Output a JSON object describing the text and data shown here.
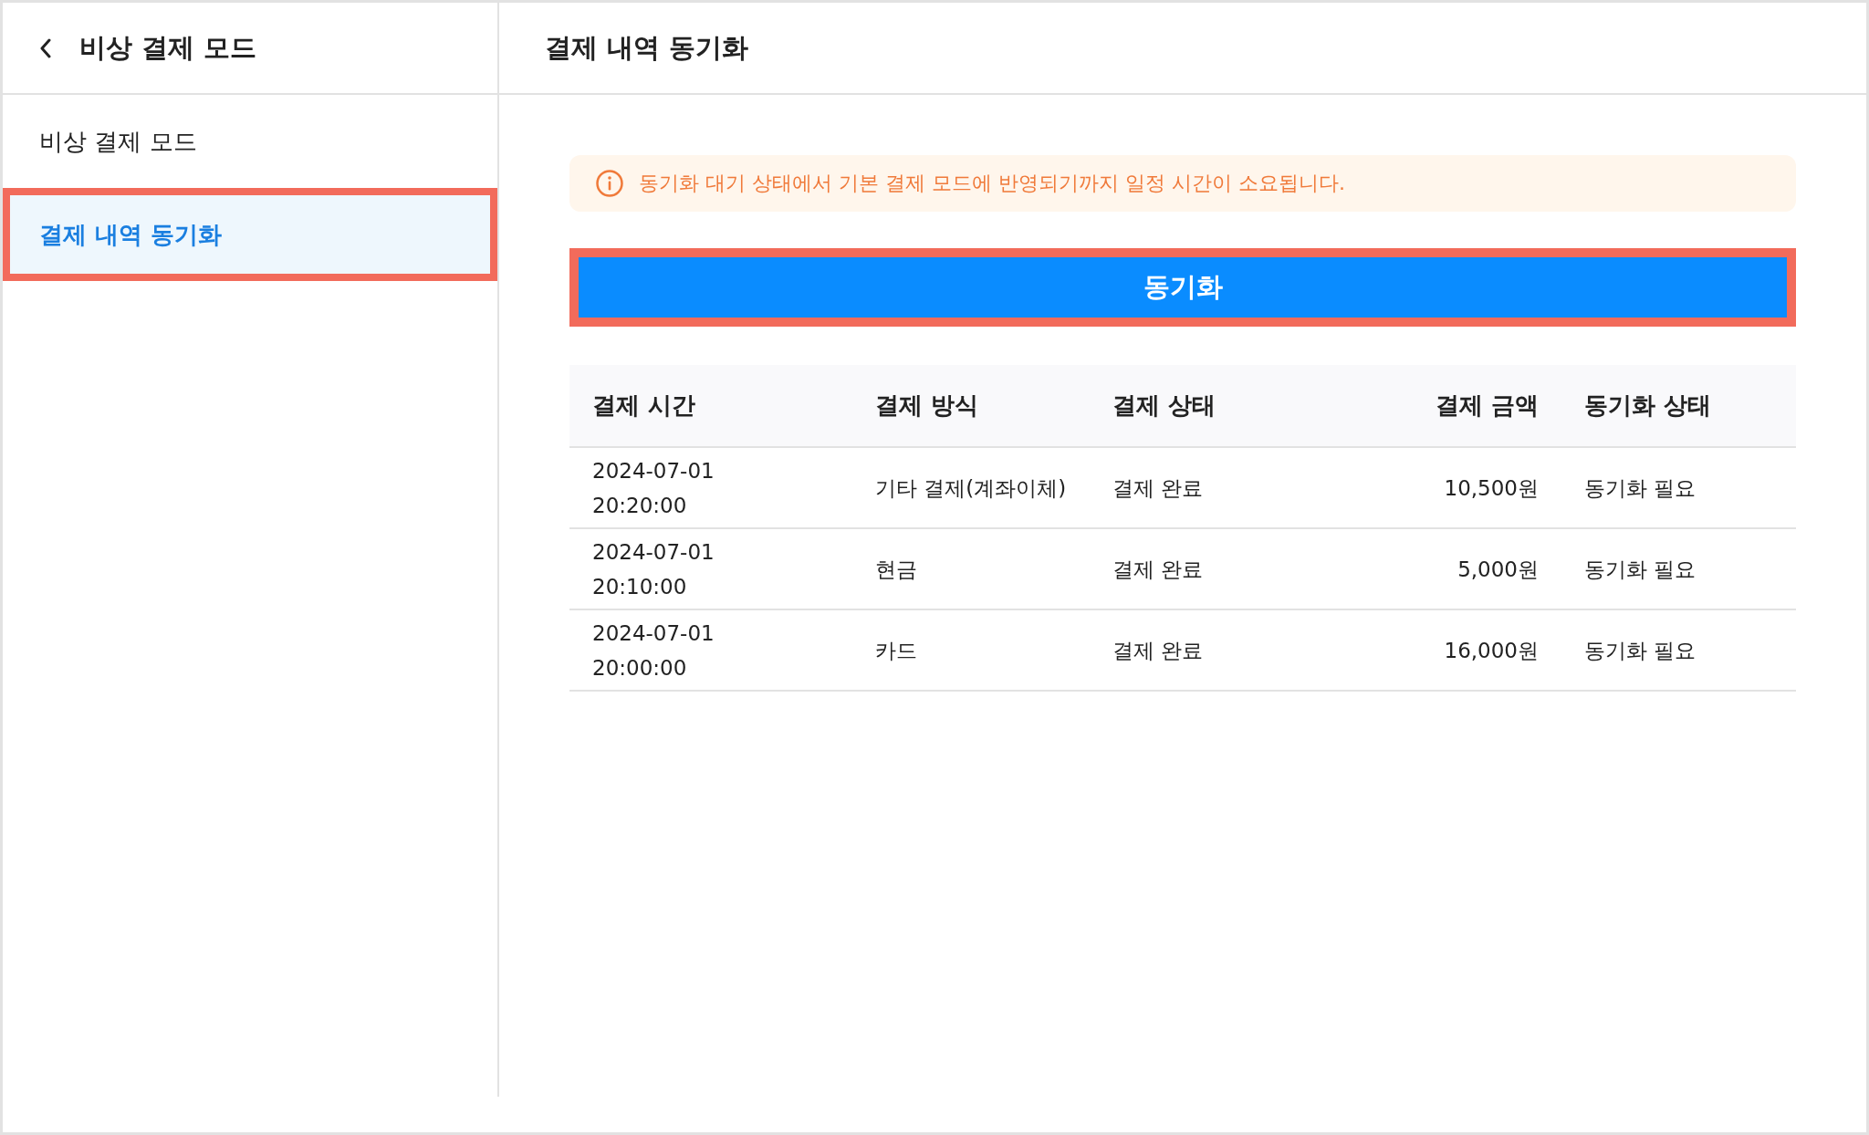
{
  "sidebar": {
    "title": "비상 결제 모드",
    "items": [
      {
        "label": "비상 결제 모드",
        "selected": false,
        "highlighted": false
      },
      {
        "label": "결제 내역 동기화",
        "selected": true,
        "highlighted": true
      }
    ]
  },
  "main": {
    "title": "결제 내역 동기화",
    "notice": "동기화 대기 상태에서 기본 결제 모드에 반영되기까지 일정 시간이 소요됩니다.",
    "sync_button": {
      "label": "동기화",
      "highlighted": true
    },
    "table": {
      "columns": [
        {
          "label": "결제 시간",
          "kind": "text"
        },
        {
          "label": "결제 방식",
          "kind": "text"
        },
        {
          "label": "결제 상태",
          "kind": "text"
        },
        {
          "label": "결제 금액",
          "kind": "amount"
        },
        {
          "label": "동기화 상태",
          "kind": "text"
        }
      ],
      "rows": [
        [
          "2024-07-01\n20:20:00",
          "기타 결제(계좌이체)",
          "결제 완료",
          "10,500원",
          "동기화 필요"
        ],
        [
          "2024-07-01\n20:10:00",
          "현금",
          "결제 완료",
          "5,000원",
          "동기화 필요"
        ],
        [
          "2024-07-01\n20:00:00",
          "카드",
          "결제 완료",
          "16,000원",
          "동기화 필요"
        ]
      ]
    }
  }
}
